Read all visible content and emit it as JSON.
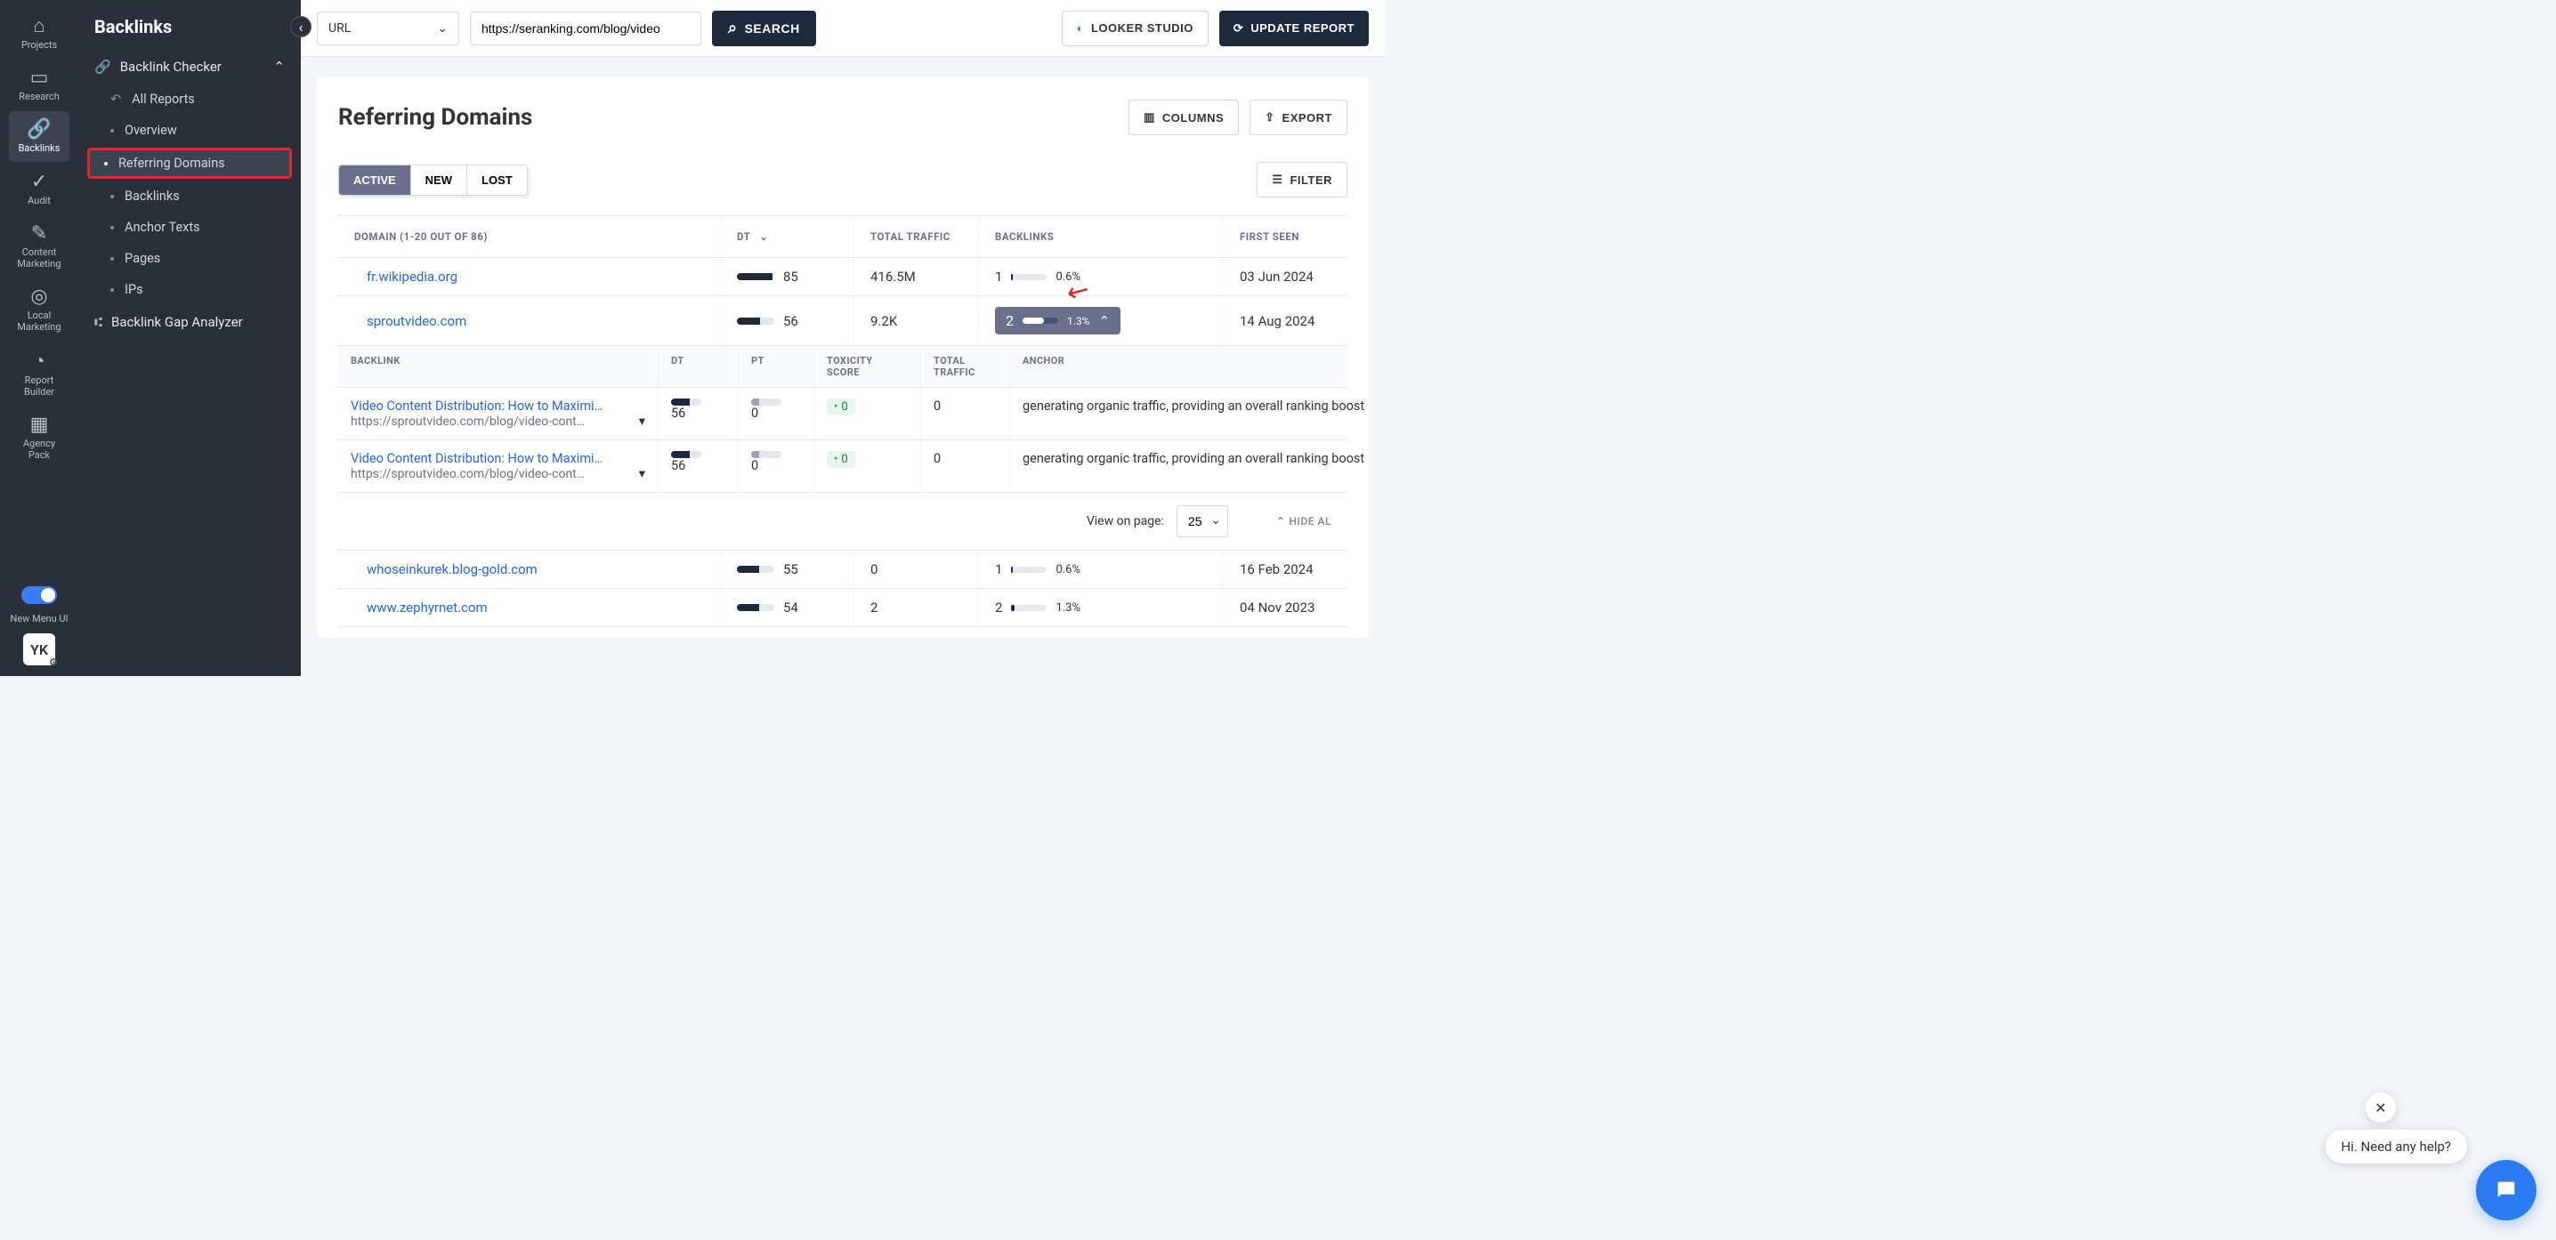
{
  "iconSidebar": {
    "items": [
      {
        "label": "Projects"
      },
      {
        "label": "Research"
      },
      {
        "label": "Backlinks"
      },
      {
        "label": "Audit"
      },
      {
        "label": "Content Marketing"
      },
      {
        "label": "Local Marketing"
      },
      {
        "label": "Report Builder"
      },
      {
        "label": "Agency Pack"
      }
    ],
    "toggleLabel": "New Menu UI",
    "avatar": "YK"
  },
  "secSidebar": {
    "title": "Backlinks",
    "group1": {
      "label": "Backlink Checker"
    },
    "links": {
      "allReports": "All Reports",
      "overview": "Overview",
      "referringDomains": "Referring Domains",
      "backlinks": "Backlinks",
      "anchorTexts": "Anchor Texts",
      "pages": "Pages",
      "ips": "IPs"
    },
    "group2": {
      "label": "Backlink Gap Analyzer"
    }
  },
  "topbar": {
    "urlTypeLabel": "URL",
    "urlValue": "https://seranking.com/blog/video",
    "searchLabel": "SEARCH",
    "lookerLabel": "LOOKER STUDIO",
    "updateLabel": "UPDATE REPORT"
  },
  "main": {
    "title": "Referring Domains",
    "columnsBtn": "COLUMNS",
    "exportBtn": "EXPORT",
    "tabs": {
      "active": "ACTIVE",
      "new": "NEW",
      "lost": "LOST"
    },
    "filterBtn": "FILTER",
    "headers": {
      "domain": "DOMAIN (1-20 OUT OF 86)",
      "dt": "DT",
      "traffic": "TOTAL TRAFFIC",
      "backlinks": "BACKLINKS",
      "firstSeen": "FIRST SEEN"
    },
    "rows": [
      {
        "domain": "fr.wikipedia.org",
        "dt": "85",
        "dtFill": "95%",
        "traffic": "416.5M",
        "blCount": "1",
        "blPct": "0.6%",
        "blFill": "5%",
        "firstSeen": "03 Jun 2024",
        "expanded": false
      },
      {
        "domain": "sproutvideo.com",
        "dt": "56",
        "dtFill": "62%",
        "traffic": "9.2K",
        "blCount": "2",
        "blPct": "1.3%",
        "blFill": "60%",
        "firstSeen": "14 Aug 2024",
        "expanded": true
      }
    ],
    "subHeaders": {
      "backlink": "BACKLINK",
      "dt": "DT",
      "pt": "PT",
      "toxicity": "TOXICITY SCORE",
      "traffic": "TOTAL TRAFFIC",
      "anchor": "ANCHOR"
    },
    "subRows": [
      {
        "title": "Video Content Distribution: How to Maximi…",
        "url": "https://sproutvideo.com/blog/video-cont…",
        "dt": "56",
        "dtFill": "62%",
        "pt": "0",
        "ptFill": "25%",
        "tox": "0",
        "traffic": "0",
        "anchor": "generating organic traffic, providing an overall ranking boost"
      },
      {
        "title": "Video Content Distribution: How to Maximi…",
        "url": "https://sproutvideo.com/blog/video-cont…",
        "dt": "56",
        "dtFill": "62%",
        "pt": "0",
        "ptFill": "25%",
        "tox": "0",
        "traffic": "0",
        "anchor": "generating organic traffic, providing an overall ranking boost"
      }
    ],
    "pager": {
      "label": "View on page:",
      "value": "25",
      "hideAll": "HIDE AL"
    },
    "rows2": [
      {
        "domain": "whoseinkurek.blog-gold.com",
        "dt": "55",
        "dtFill": "60%",
        "traffic": "0",
        "blCount": "1",
        "blPct": "0.6%",
        "blFill": "5%",
        "firstSeen": "16 Feb 2024"
      },
      {
        "domain": "www.zephyrnet.com",
        "dt": "54",
        "dtFill": "59%",
        "traffic": "2",
        "blCount": "2",
        "blPct": "1.3%",
        "blFill": "8%",
        "firstSeen": "04 Nov 2023"
      }
    ]
  },
  "chat": {
    "tooltip": "Hi. Need any help?"
  }
}
